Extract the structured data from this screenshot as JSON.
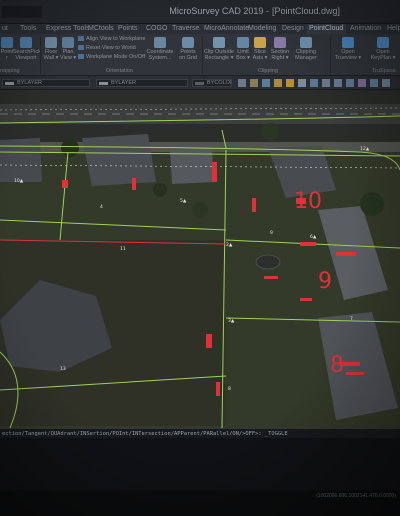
{
  "window": {
    "title": "MicroSurvey CAD 2019 -",
    "document": "[PointCloud.dwg]"
  },
  "ribbon_tabs": [
    "ut",
    "Tools",
    "Express Tools",
    "MCtools",
    "Points",
    "COGO",
    "Traverse",
    "MicroAnnotate",
    "Modeling",
    "Design",
    "PointCloud",
    "Animation",
    "Help"
  ],
  "active_tab": "PointCloud",
  "ribbon": {
    "buttons": [
      {
        "label": "Point",
        "label2": "r",
        "color": "#4a78a6"
      },
      {
        "label": "SearchPick",
        "label2": "Viewport",
        "color": "#4f7da8"
      },
      {
        "label": "Floor",
        "label2": "Wall ▾",
        "color": "#6e8aa3"
      },
      {
        "label": "Plan",
        "label2": "View ▾",
        "color": "#5f7e9c"
      },
      {
        "label": "Coordinate",
        "label2": "System...",
        "color": "#6a86a0"
      },
      {
        "label": "Points",
        "label2": "on Grid",
        "color": "#6b8aa8"
      },
      {
        "label": "Clip Outside",
        "label2": "Rectangle ▾",
        "color": "#7592ad"
      },
      {
        "label": "Limit",
        "label2": "Box ▾",
        "color": "#6486a4"
      },
      {
        "label": "Slice",
        "label2": "Axis ▾",
        "color": "#c7a44c"
      },
      {
        "label": "Section",
        "label2": "Right ▾",
        "color": "#8a7aa8"
      },
      {
        "label": "Clipping",
        "label2": "Manager",
        "color": "#6f92b0"
      },
      {
        "label": "Open",
        "label2": "Trueview ▾",
        "color": "#4b86c0"
      },
      {
        "label": "Open",
        "label2": "KeyPlan ▾",
        "color": "#4b86c0"
      }
    ],
    "rows": [
      "Align View to Workplane",
      "Reset View to World",
      "Workplane Mode On/Off"
    ],
    "groups": [
      "napping",
      "Orientation",
      "Clipping",
      "TruSpace"
    ]
  },
  "layer_toolbar": {
    "layer_left": "BYLAYER",
    "layer_right": "BYLAYER",
    "color": "BYCOLOR"
  },
  "drawing": {
    "point_labels": [
      "2▲",
      "3▲",
      "4",
      "5▲",
      "6▲",
      "7",
      "8",
      "9",
      "10▲",
      "11",
      "12▲",
      "13"
    ],
    "big_numbers": [
      "10",
      "9",
      "8"
    ],
    "survey_lines_color": "#9fd15a",
    "annotation_color": "#e0303a"
  },
  "command_line": {
    "text": "ection/Tangent/QUAdrant/INSertion/POInt/INTersection/APParent/PARallel/ON/>OFF>: _TOGGLE"
  },
  "status": {
    "coords": "(1002096.806,1002141.476,0.0000)"
  }
}
